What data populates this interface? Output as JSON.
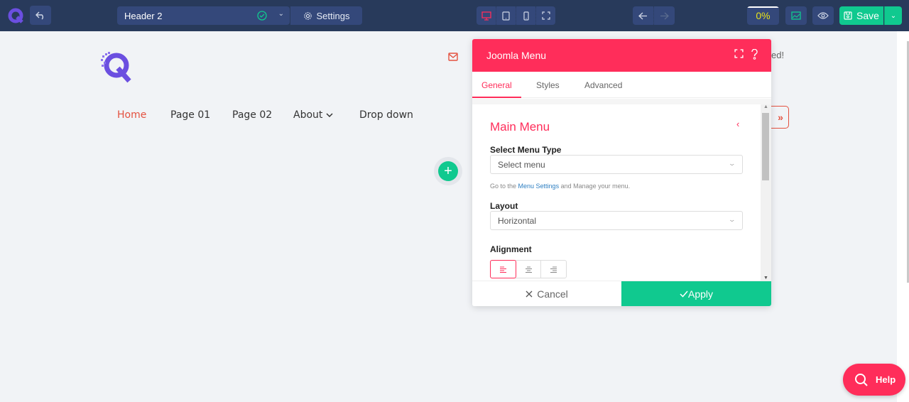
{
  "toolbar": {
    "header_name": "Header 2",
    "settings_label": "Settings",
    "progress_text": "0%",
    "progress_value": 0,
    "save_label": "Save",
    "active_device": "desktop",
    "colors": {
      "bg": "#283a5b",
      "button": "#34487a",
      "accent_green": "#10c98f",
      "device_active": "#ff2d5a",
      "progress_text": "#e7e21a"
    }
  },
  "site": {
    "nav": [
      {
        "label": "Home",
        "active": true
      },
      {
        "label": "Page 01",
        "active": false
      },
      {
        "label": "Page 02",
        "active": false
      },
      {
        "label": "About",
        "active": false,
        "has_dropdown": true
      },
      {
        "label": "Drop down",
        "active": false
      }
    ],
    "topline_text": "ed!",
    "offcanvas_icon": "»",
    "add_icon": "+",
    "accent": "#e4513f"
  },
  "modal": {
    "title": "Joomla Menu",
    "tabs": [
      {
        "label": "General",
        "active": true
      },
      {
        "label": "Styles",
        "active": false
      },
      {
        "label": "Advanced",
        "active": false
      }
    ],
    "section_title": "Main Menu",
    "fields": {
      "menu_type_label": "Select Menu Type",
      "menu_type_value": "Select menu",
      "help_prefix": "Go to the ",
      "help_link": "Menu Settings",
      "help_suffix": " and Manage your menu.",
      "layout_label": "Layout",
      "layout_value": "Horizontal",
      "alignment_label": "Alignment",
      "alignment_options": [
        "left",
        "center",
        "right"
      ],
      "alignment_selected": "left"
    },
    "cancel_label": "Cancel",
    "apply_label": "Apply",
    "accent": "#ff2d5a"
  },
  "help_button": {
    "label": "Help"
  }
}
